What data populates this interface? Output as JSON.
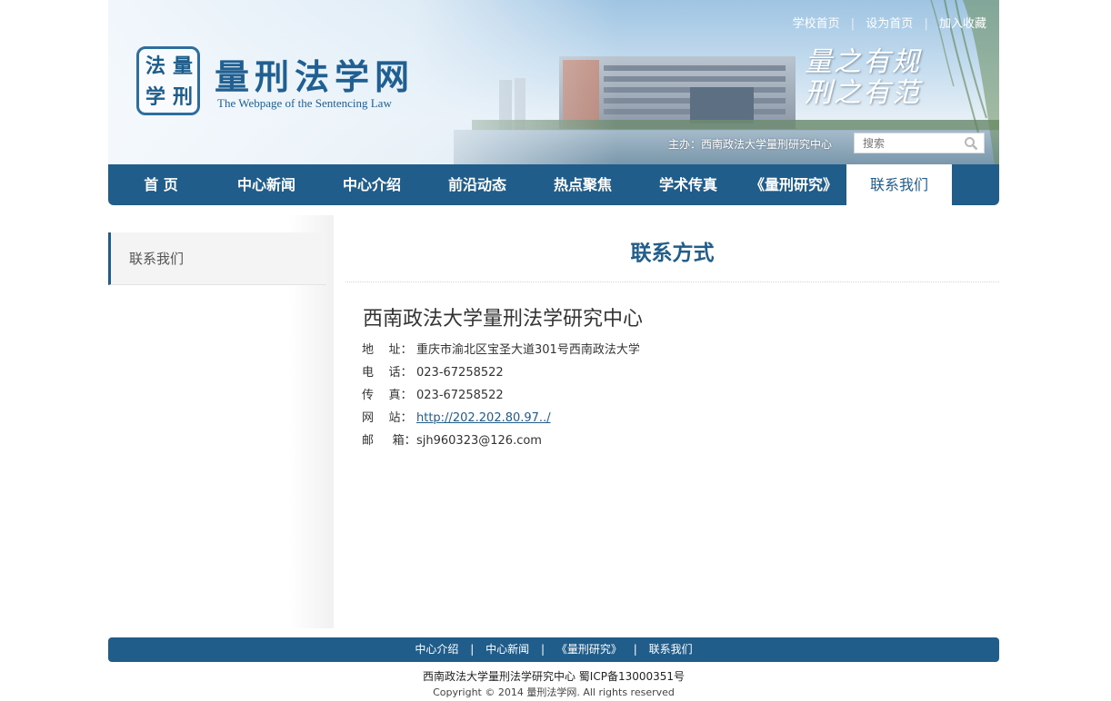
{
  "header": {
    "top_links": [
      "学校首页",
      "设为首页",
      "加入收藏"
    ],
    "logo_seal_chars": [
      "法",
      "量",
      "学",
      "刑"
    ],
    "logo_cn": "量刑法学网",
    "logo_en": "The Webpage of the Sentencing Law",
    "motto_line1": "量之有规",
    "motto_line2": "刑之有范",
    "host_text": "主办：西南政法大学量刑研究中心",
    "search_placeholder": "搜索"
  },
  "nav": {
    "items": [
      "首 页",
      "中心新闻",
      "中心介绍",
      "前沿动态",
      "热点聚焦",
      "学术传真",
      "《量刑研究》",
      "联系我们"
    ],
    "active_index": 7
  },
  "sidebar": {
    "items": [
      "联系我们"
    ]
  },
  "main": {
    "title": "联系方式",
    "org_name": "西南政法大学量刑法学研究中心",
    "contacts": [
      {
        "label": "地    址：",
        "value": "重庆市渝北区宝圣大道301号西南政法大学"
      },
      {
        "label": "电    话：",
        "value": "023-67258522"
      },
      {
        "label": "传    真：",
        "value": "023-67258522"
      },
      {
        "label": "网    站：",
        "value": "http://202.202.80.97../"
      },
      {
        "label": "邮     箱：",
        "value": "sjh960323@126.com"
      }
    ]
  },
  "footer": {
    "links": [
      "中心介绍",
      "中心新闻",
      "《量刑研究》",
      "联系我们"
    ],
    "line1": "西南政法大学量刑法学研究中心  蜀ICP备13000351号",
    "line2": "Copyright © 2014 量刑法学网. All rights reserved"
  },
  "colors": {
    "brand": "#215d8b",
    "banner_sky": "#c9dff0",
    "text": "#333333"
  }
}
